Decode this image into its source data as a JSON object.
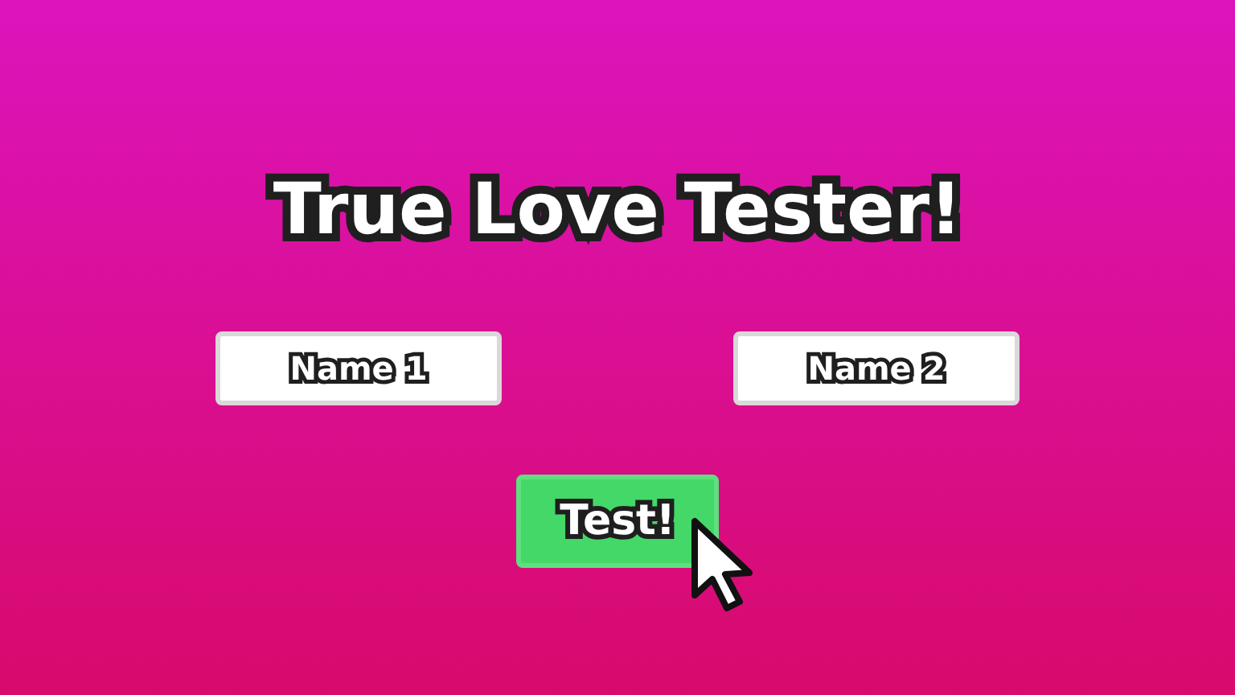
{
  "title": "True Love Tester!",
  "name_fields": [
    {
      "placeholder": "Name 1"
    },
    {
      "placeholder": "Name 2"
    }
  ],
  "test_button": {
    "label": "Test!"
  }
}
